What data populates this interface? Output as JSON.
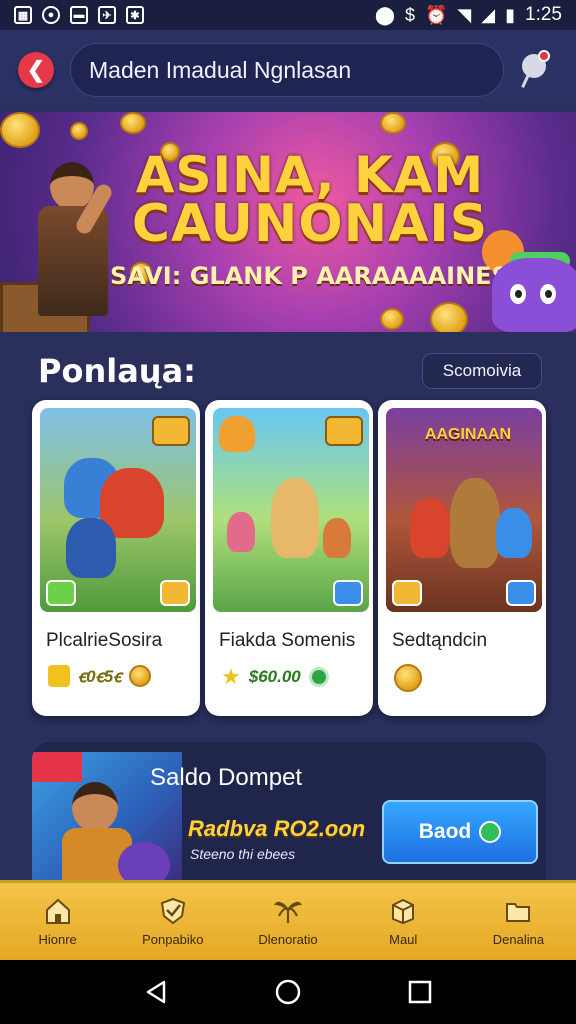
{
  "status_bar": {
    "time": "1:25"
  },
  "header": {
    "search_text": "Maden Imadual Ngnlasan"
  },
  "banner": {
    "title_line1": "ASINA, KAM",
    "title_line2": "CAUNONAIS",
    "subtitle": "SAVI: GLANK P AARAAAAINES."
  },
  "section": {
    "title": "Ponlaųa:",
    "button": "Scomoivia"
  },
  "games": [
    {
      "name": "PlcalrieSosira",
      "price": "ꞓ0ꞓ5ꞓ",
      "art_title": ""
    },
    {
      "name": "Fiakda Somenis",
      "price": "$60.00",
      "art_title": ""
    },
    {
      "name": "Sedtąndcin",
      "price": "",
      "art_title": "AAGINAAN"
    }
  ],
  "wallet": {
    "title": "Saldo Dompet",
    "amount": "Radbva RO2.oon",
    "subtext": "Steeno thi ebees",
    "button": "Baod"
  },
  "bottom_nav": [
    {
      "label": "Hionre",
      "icon": "home-icon"
    },
    {
      "label": "Ponpabiko",
      "icon": "shield-check-icon"
    },
    {
      "label": "Dlenoratio",
      "icon": "palm-leaf-icon"
    },
    {
      "label": "Maul",
      "icon": "box-icon"
    },
    {
      "label": "Denalina",
      "icon": "folder-icon"
    }
  ],
  "colors": {
    "accent": "#e5394a",
    "nav_bg": "#f0b636",
    "page_bg": "#2a2f5c"
  }
}
